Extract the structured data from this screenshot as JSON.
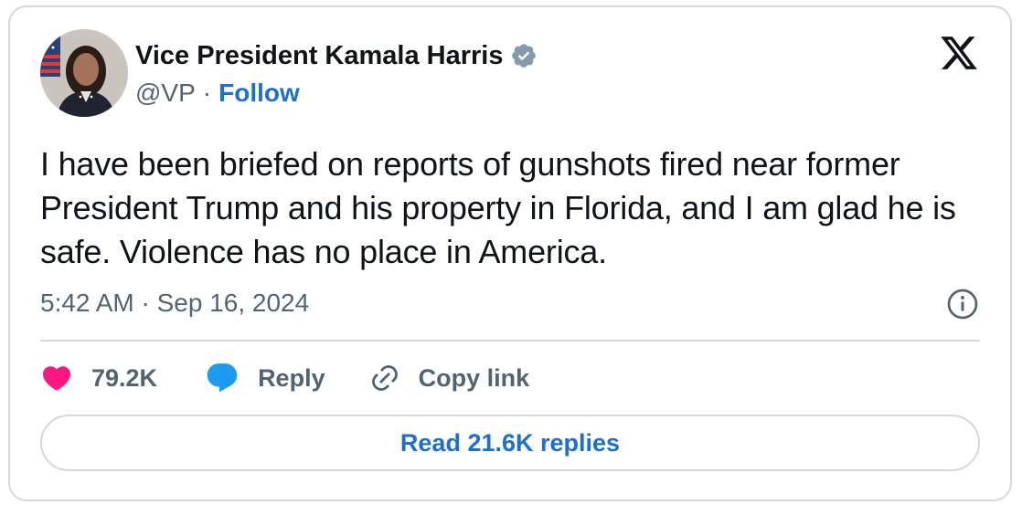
{
  "author": {
    "display_name": "Vice President Kamala Harris",
    "handle": "@VP",
    "separator": "·",
    "follow_label": "Follow",
    "verified_icon": "verified-badge-icon",
    "avatar": "profile-photo"
  },
  "tweet": {
    "text": "I have been briefed on reports of gunshots fired near former President Trump and his property in Florida, and I am glad he is safe. Violence has no place in America.",
    "timestamp": "5:42 AM · Sep 16, 2024"
  },
  "actions": {
    "like_count": "79.2K",
    "reply_label": "Reply",
    "copy_link_label": "Copy link",
    "read_replies_label": "Read 21.6K replies"
  },
  "icons": {
    "x_logo": "x-logo-icon",
    "info": "info-icon",
    "like": "heart-icon",
    "reply": "speech-bubble-icon",
    "copy": "link-icon"
  },
  "colors": {
    "link_blue": "#1d6fd0",
    "heart_pink": "#f91880",
    "reply_blue": "#1d9bf0",
    "muted_text": "#536471",
    "border": "#cfd9de",
    "verified_gray": "#829aab"
  }
}
